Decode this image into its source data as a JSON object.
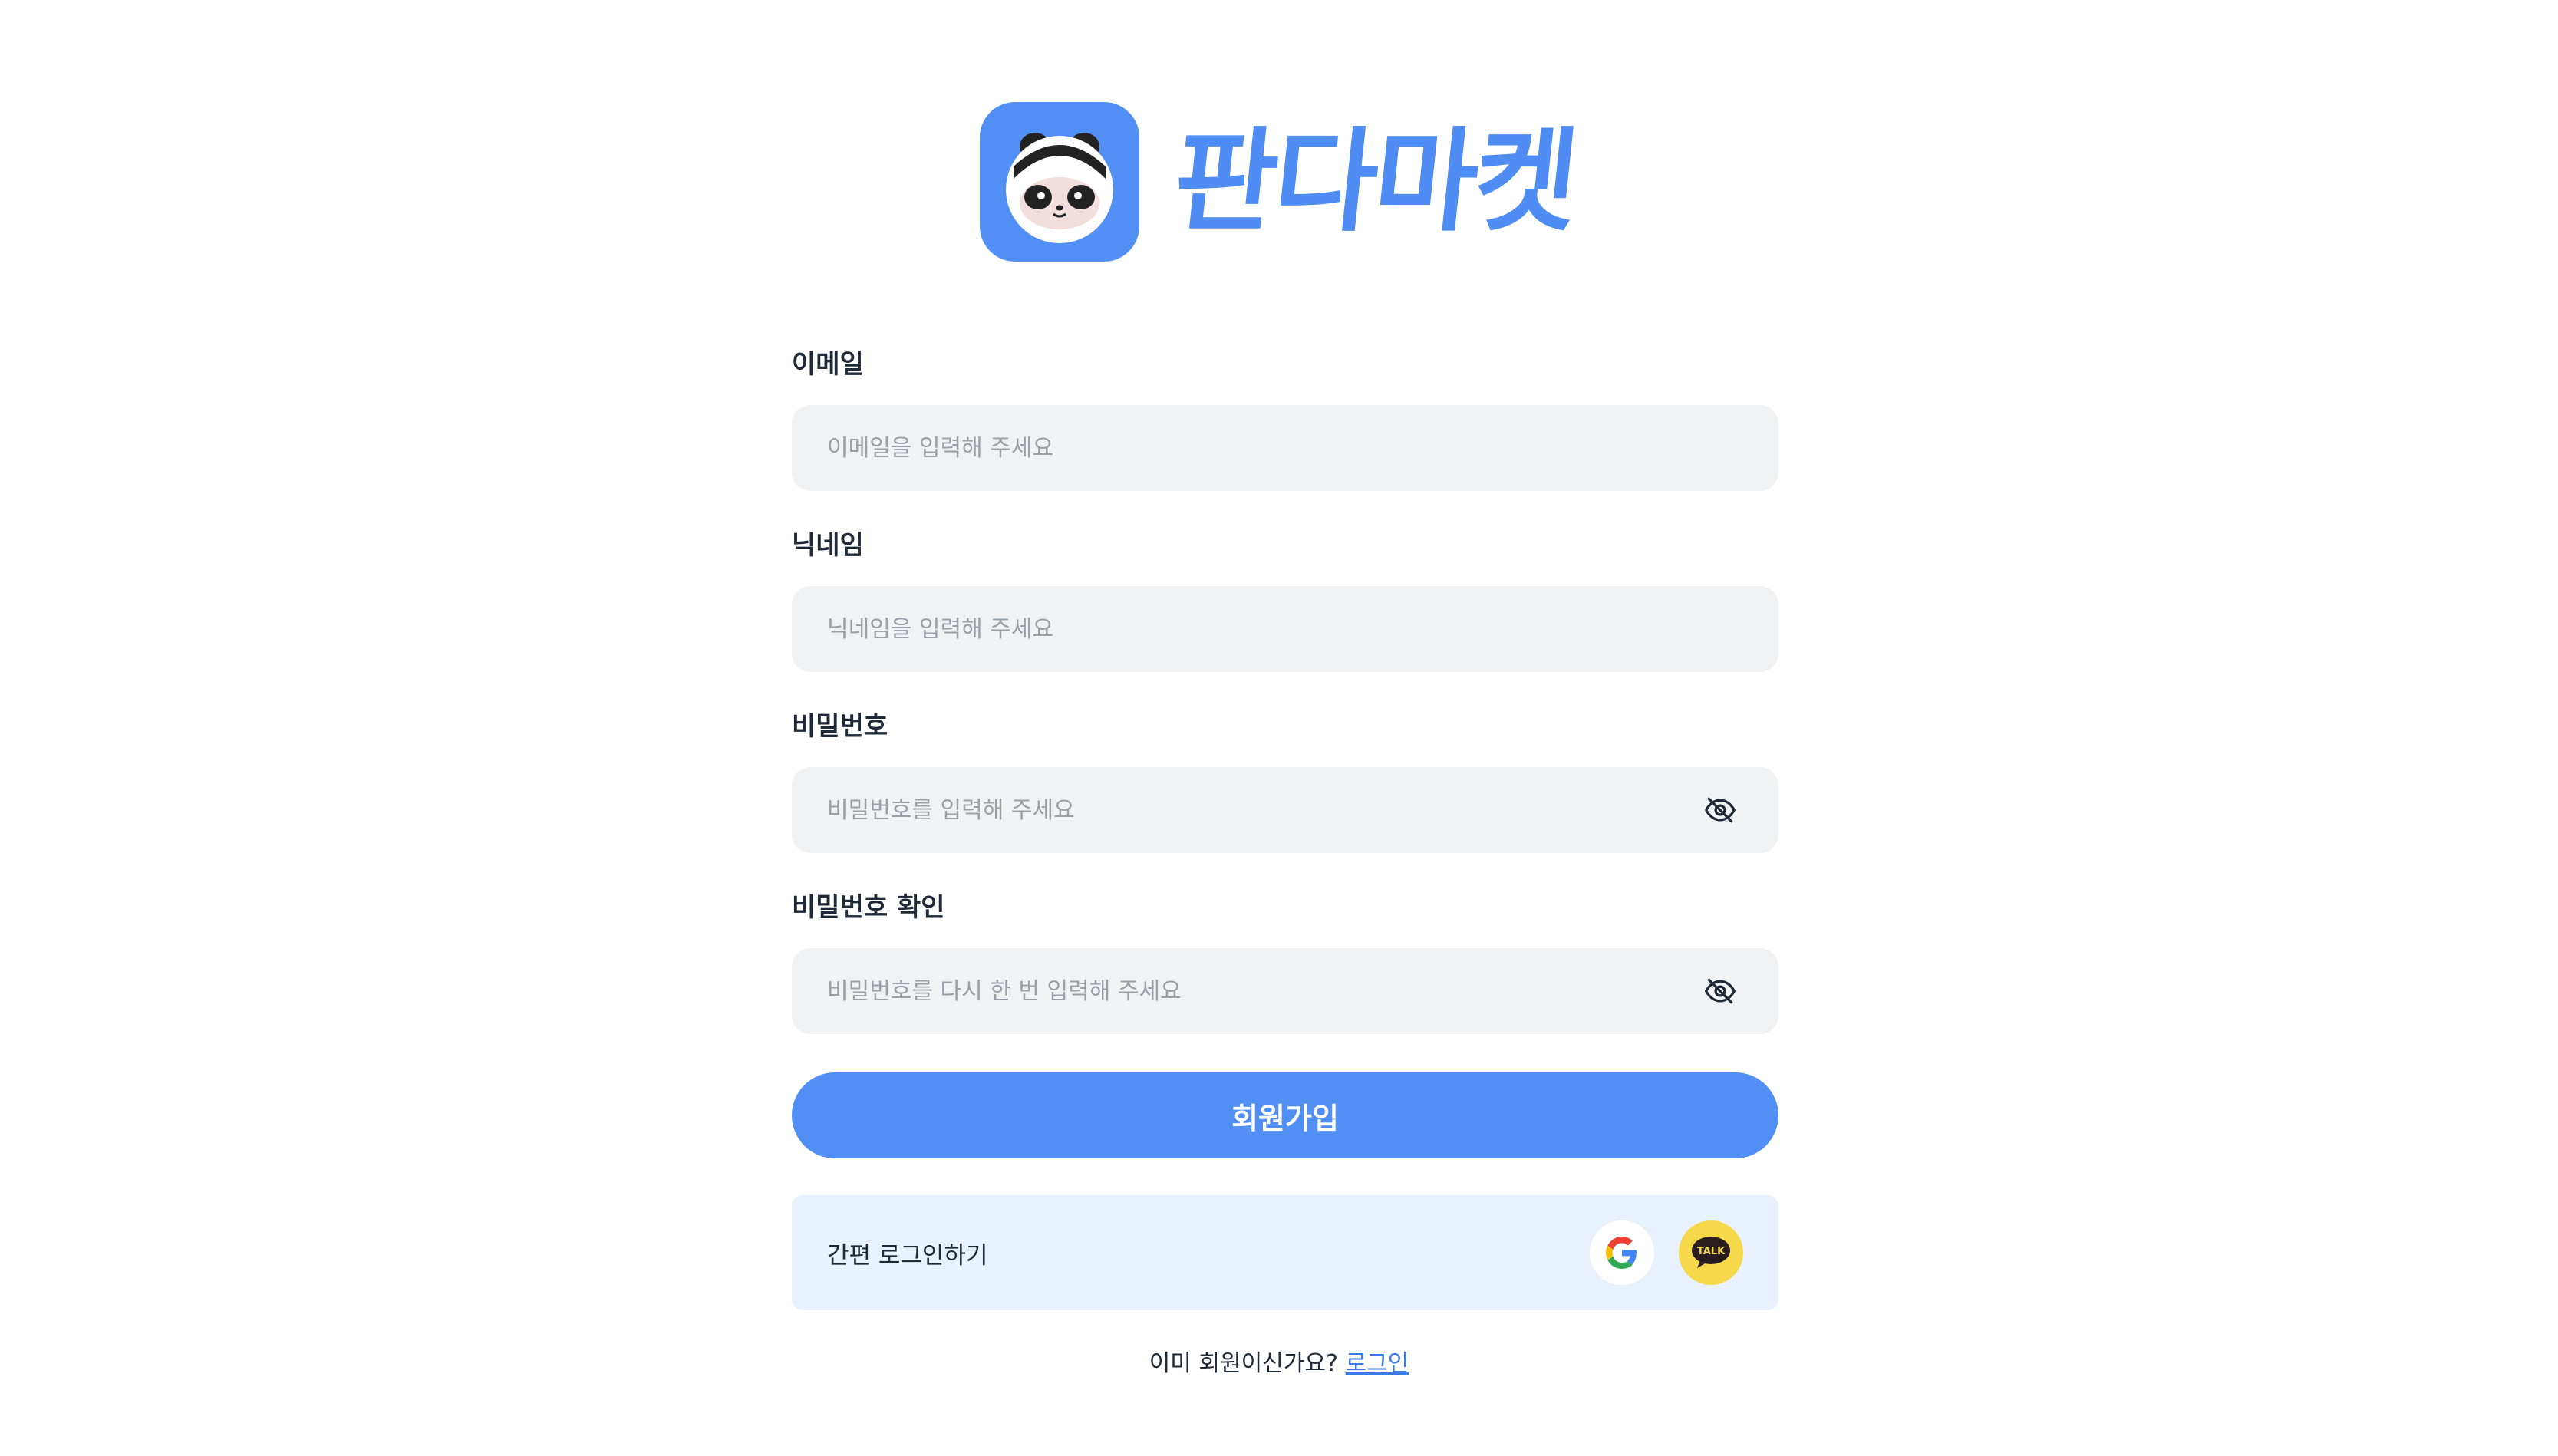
{
  "brand": {
    "name": "판다마켓",
    "icon": "panda-logo-icon",
    "color": "#4f8cf4"
  },
  "form": {
    "email": {
      "label": "이메일",
      "placeholder": "이메일을 입력해 주세요"
    },
    "nickname": {
      "label": "닉네임",
      "placeholder": "닉네임을 입력해 주세요"
    },
    "password": {
      "label": "비밀번호",
      "placeholder": "비밀번호를 입력해 주세요",
      "toggle_icon": "eye-off-icon"
    },
    "password_confirm": {
      "label": "비밀번호 확인",
      "placeholder": "비밀번호를 다시 한 번 입력해 주세요",
      "toggle_icon": "eye-off-icon"
    },
    "submit_label": "회원가입",
    "accent_color": "#528ff5"
  },
  "social_login": {
    "label": "간편 로그인하기",
    "providers": [
      {
        "name": "google",
        "icon": "google-icon"
      },
      {
        "name": "kakao",
        "icon": "kakao-talk-icon",
        "icon_text": "TALK"
      }
    ]
  },
  "footer": {
    "question": "이미 회원이신가요?",
    "link_label": "로그인"
  }
}
